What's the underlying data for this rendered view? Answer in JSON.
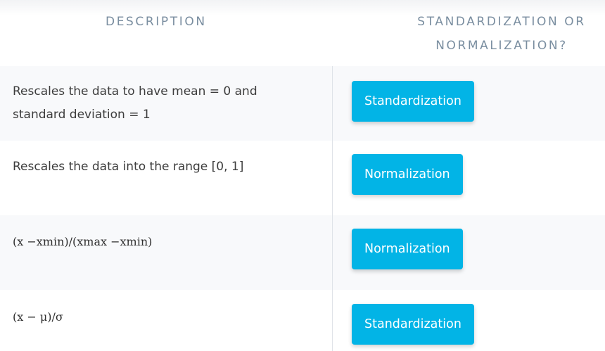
{
  "headers": {
    "description": "DESCRIPTION",
    "method_line1": "STANDARDIZATION OR",
    "method_line2": "NORMALIZATION?"
  },
  "rows": [
    {
      "description": "Rescales the data to have mean = 0 and standard deviation = 1",
      "answer": "Standardization"
    },
    {
      "description": "Rescales the data into the range [0, 1]",
      "answer": "Normalization"
    },
    {
      "description": "(x −xmin)/(xmax −xmin)",
      "answer": "Normalization"
    },
    {
      "description": "(x − μ)/σ",
      "answer": "Standardization"
    }
  ],
  "colors": {
    "button_bg": "#02b4e6",
    "header_text": "#7a8ea0",
    "row_shade": "#f8f9fb"
  }
}
